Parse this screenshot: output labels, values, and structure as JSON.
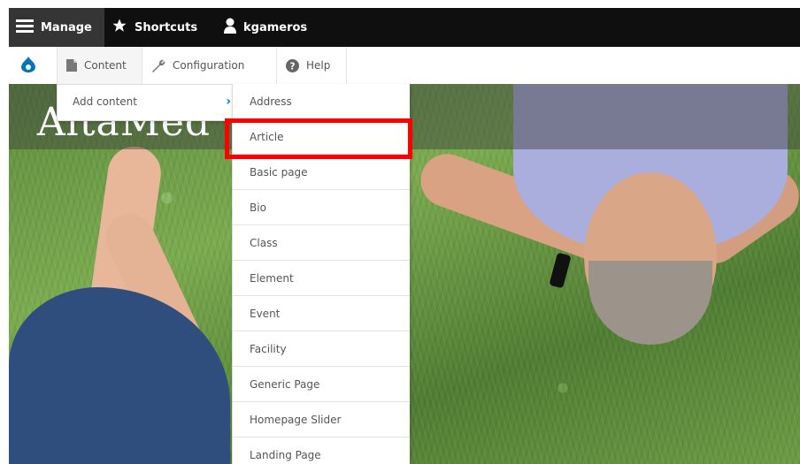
{
  "toolbar": {
    "manage_label": "Manage",
    "shortcuts_label": "Shortcuts",
    "user_label": "kgameros"
  },
  "tray": {
    "home_icon": "drupal-drop-icon",
    "content_label": "Content",
    "configuration_label": "Configuration",
    "help_label": "Help"
  },
  "site": {
    "logo_text": "AltaMed"
  },
  "menu": {
    "add_content_label": "Add content",
    "content_types": [
      "Address",
      "Article",
      "Basic page",
      "Bio",
      "Class",
      "Element",
      "Event",
      "Facility",
      "Generic Page",
      "Homepage Slider",
      "Landing Page"
    ],
    "highlighted_item": "Article"
  },
  "colors": {
    "admin_bar": "#0f0f0f",
    "manage_tab": "#353535",
    "accent_blue": "#0074bd",
    "highlight_red": "#ff0000"
  }
}
